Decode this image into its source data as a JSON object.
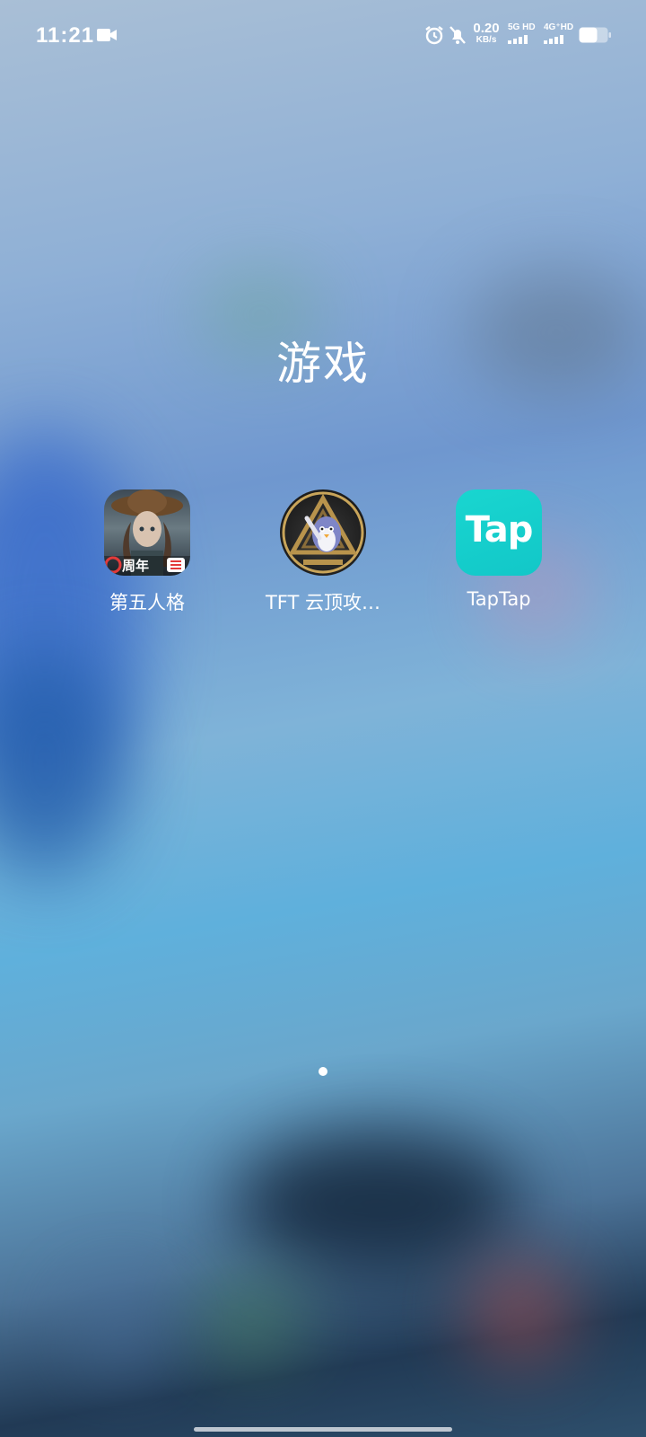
{
  "status_bar": {
    "time": "11:21",
    "network_speed_value": "0.20",
    "network_speed_unit": "KB/s",
    "sim1_label": "5G HD",
    "sim2_label": "4G⁺HD",
    "icons": [
      "video-record-icon",
      "alarm-icon",
      "mute-bell-icon",
      "signal-icon",
      "battery-icon"
    ]
  },
  "folder": {
    "title": "游戏",
    "apps": [
      {
        "label": "第五人格",
        "icon": "identity-v-app-icon",
        "badge_text": "周年"
      },
      {
        "label": "TFT 云顶攻…",
        "icon": "tft-app-icon"
      },
      {
        "label": "TapTap",
        "icon": "taptap-app-icon",
        "icon_text": "Tap"
      }
    ]
  },
  "pagination": {
    "pages": 1,
    "current": 1
  },
  "colors": {
    "taptap_brand": "#15CFCB",
    "text": "#FFFFFF"
  }
}
